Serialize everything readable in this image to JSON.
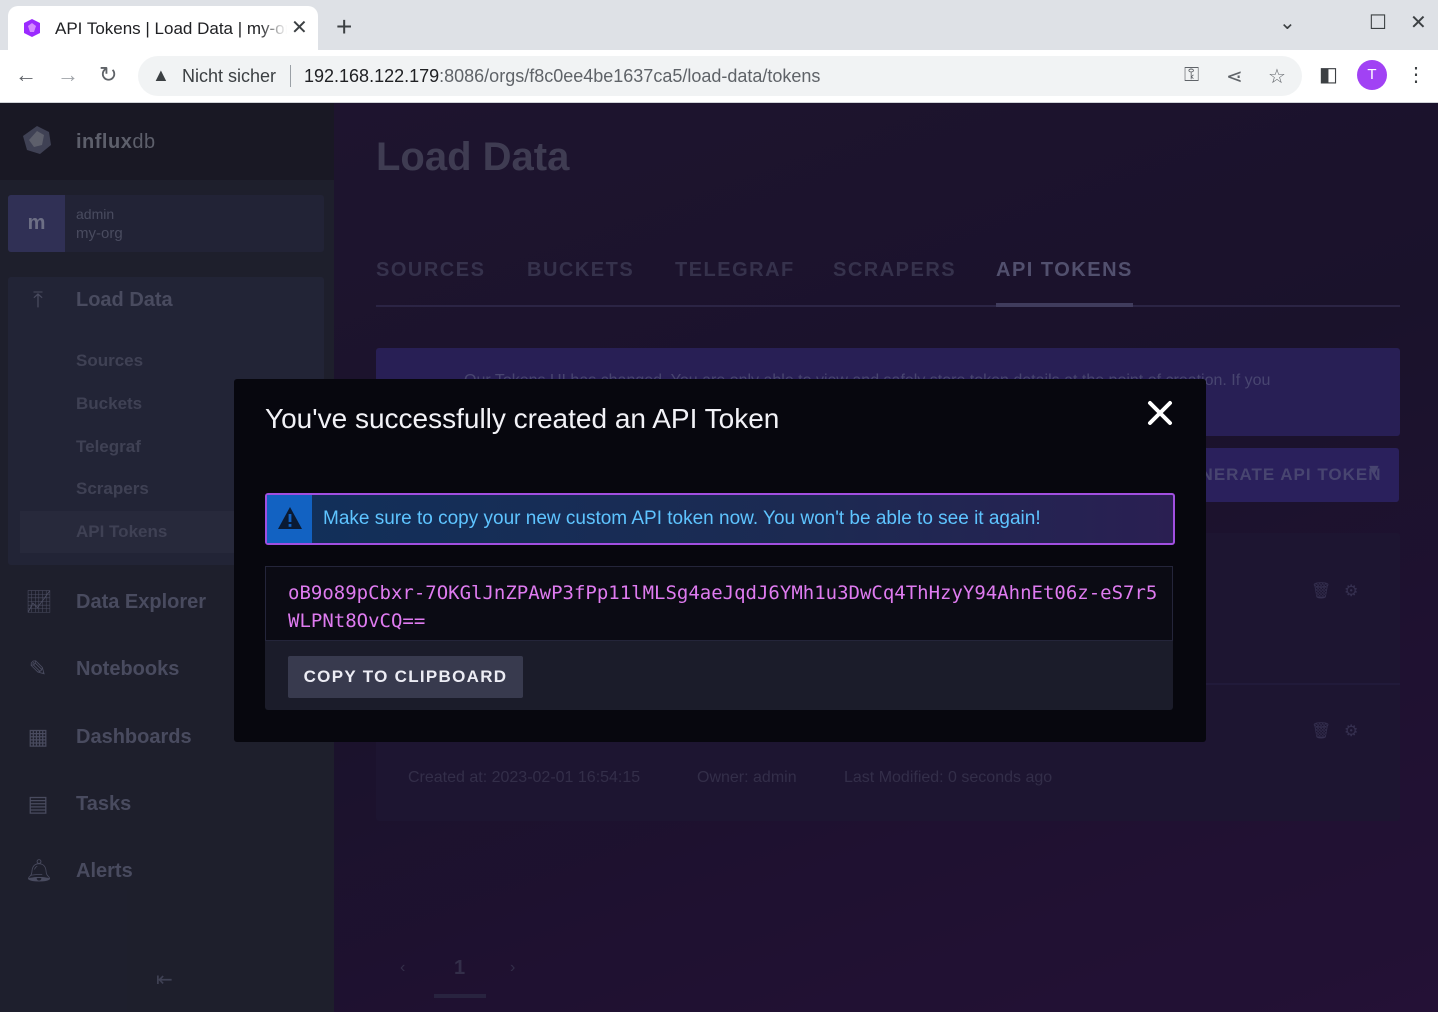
{
  "browser": {
    "tab_title": "API Tokens | Load Data | my-org | InfluxDB",
    "security_label": "Nicht sicher",
    "url_host": "192.168.122.179",
    "url_rest": ":8086/orgs/f8c0ee4be1637ca5/load-data/tokens",
    "profile_initial": "T"
  },
  "sidebar": {
    "logo_bold": "influx",
    "logo_light": "db",
    "org_avatar": "m",
    "org_user": "admin",
    "org_name": "my-org",
    "load_data_label": "Load Data",
    "sub_items": [
      "Sources",
      "Buckets",
      "Telegraf",
      "Scrapers",
      "API Tokens"
    ],
    "nav_items": [
      "Data Explorer",
      "Notebooks",
      "Dashboards",
      "Tasks",
      "Alerts"
    ]
  },
  "main": {
    "page_title": "Load Data",
    "tabs": [
      "SOURCES",
      "BUCKETS",
      "TELEGRAF",
      "SCRAPERS",
      "API TOKENS"
    ],
    "active_tab": "API TOKENS",
    "banner_text": "Our Tokens UI has changed. You are only able to view and safely store token details at the point of creation. If you",
    "generate_button": "GENERATE API TOKEN",
    "token_meta": {
      "created": "Created at: 2023-02-01 16:54:15",
      "owner": "Owner: admin",
      "modified": "Last Modified: 0 seconds ago"
    },
    "page_number": "1"
  },
  "modal": {
    "title": "You've successfully created an API Token",
    "alert_text": "Make sure to copy your new custom API token now. You won't be able to see it again!",
    "token": "oB9o89pCbxr-7OKGlJnZPAwP3fPp11lMLSg4aeJqdJ6YMh1u3DwCq4ThHzyY94AhnEt06z-eS7r5WLPNt8OvCQ==",
    "copy_button": "COPY TO CLIPBOARD"
  },
  "colors": {
    "accent_purple": "#a14fe0",
    "info_blue": "#1262c2",
    "token_pink": "#df7bf0"
  }
}
